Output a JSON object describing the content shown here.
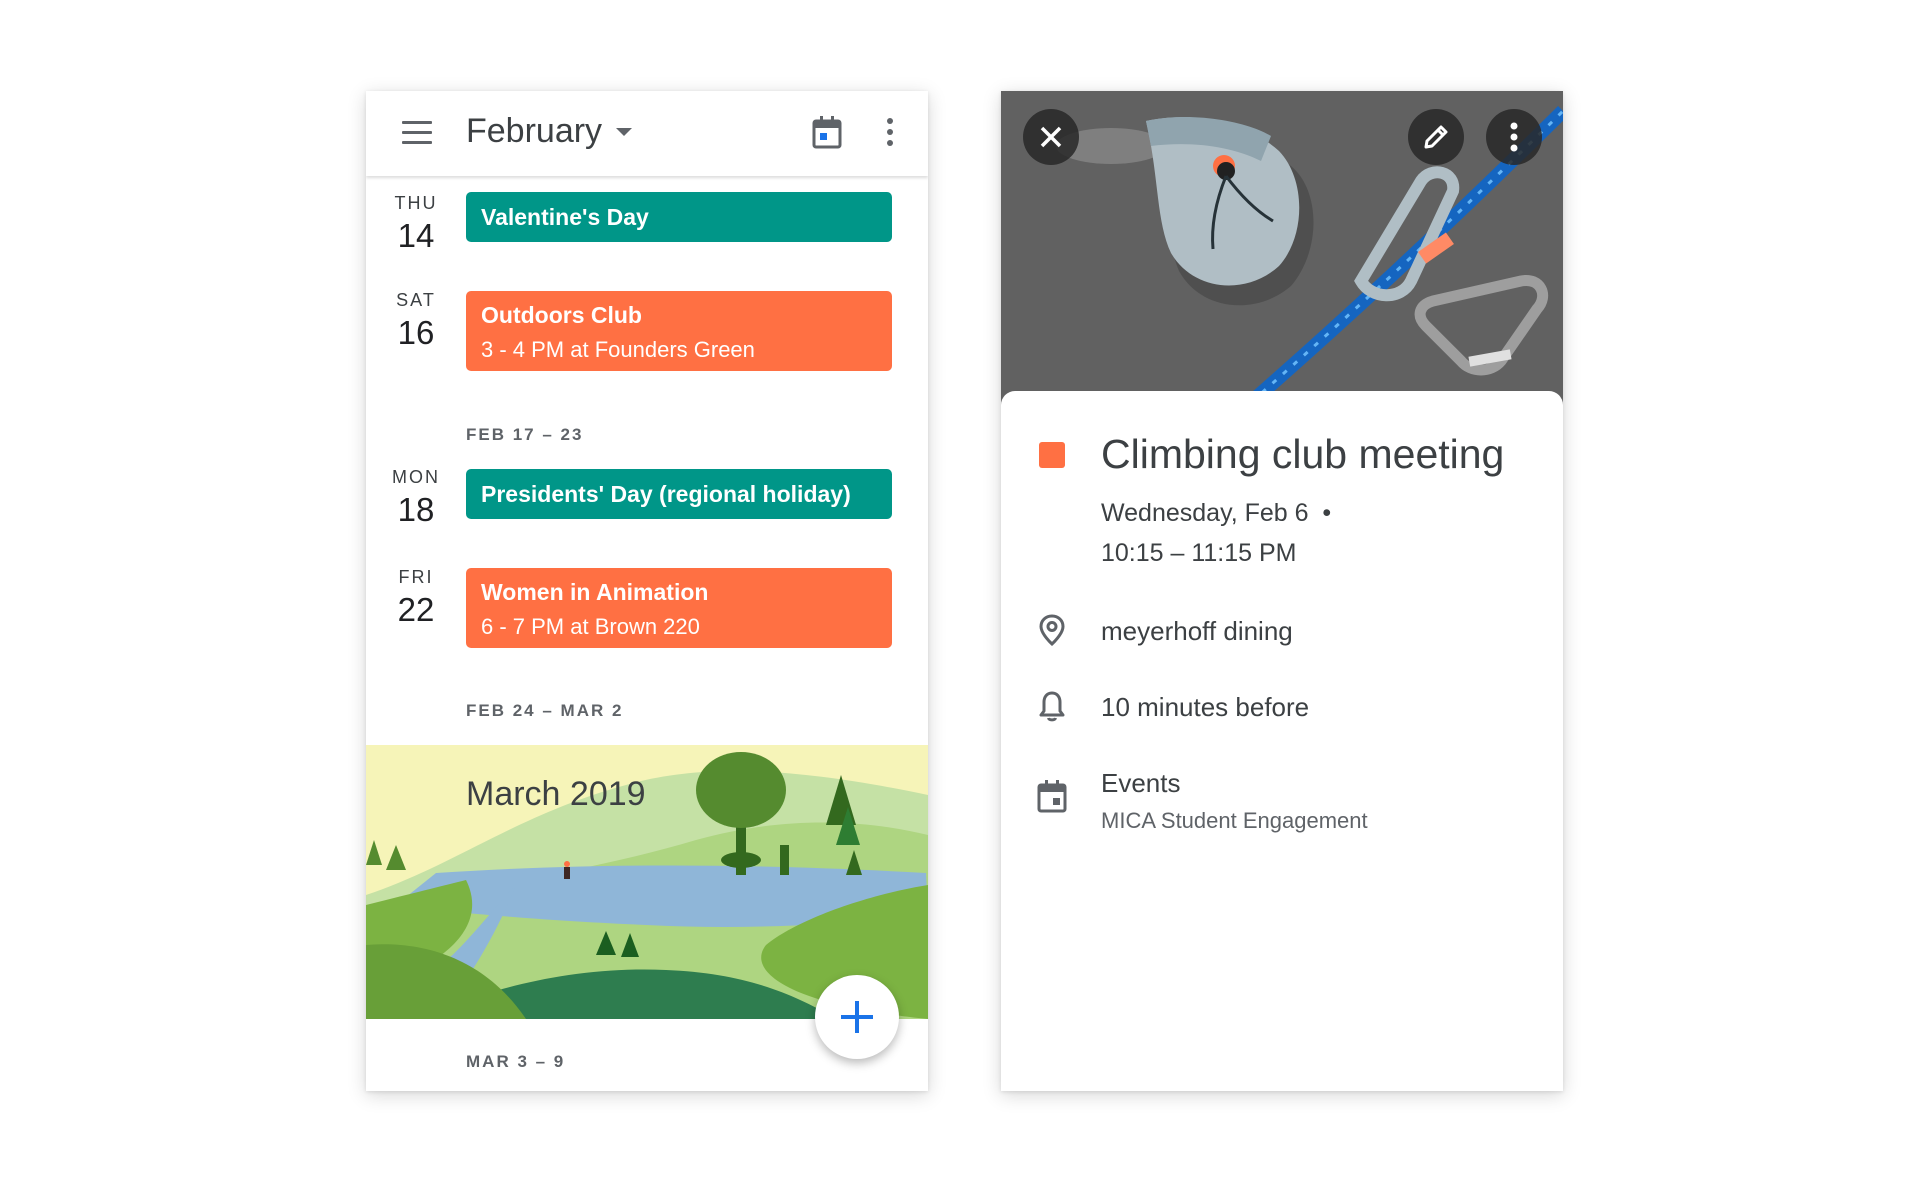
{
  "agenda": {
    "month_title": "February",
    "days": [
      {
        "dow": "THU",
        "date": "14"
      },
      {
        "dow": "SAT",
        "date": "16"
      },
      {
        "dow": "MON",
        "date": "18"
      },
      {
        "dow": "FRI",
        "date": "22"
      }
    ],
    "events": [
      {
        "title": "Valentine's Day",
        "color": "#009688"
      },
      {
        "title": "Outdoors Club",
        "subtitle": "3 - 4 PM at Founders Green",
        "color": "#ff7043"
      },
      {
        "title": "Presidents' Day (regional holiday)",
        "color": "#009688"
      },
      {
        "title": "Women in Animation",
        "subtitle": "6 - 7 PM at Brown 220",
        "color": "#ff7043"
      }
    ],
    "week_headers": [
      "FEB 17 – 23",
      "FEB 24 – MAR 2",
      "MAR 3 – 9"
    ],
    "month_banner": "March 2019"
  },
  "detail": {
    "title": "Climbing club meeting",
    "date_line": "Wednesday, Feb 6  •",
    "time_line": "10:15 – 11:15 PM",
    "location": "meyerhoff dining",
    "reminder": "10 minutes before",
    "calendar_name": "Events",
    "calendar_owner": "MICA Student Engagement",
    "event_color": "#ff7043"
  },
  "icons": [
    "menu-icon",
    "dropdown-caret-icon",
    "today-calendar-icon",
    "more-vert-icon",
    "plus-icon",
    "close-icon",
    "edit-pencil-icon",
    "location-pin-icon",
    "bell-icon",
    "calendar-icon"
  ]
}
